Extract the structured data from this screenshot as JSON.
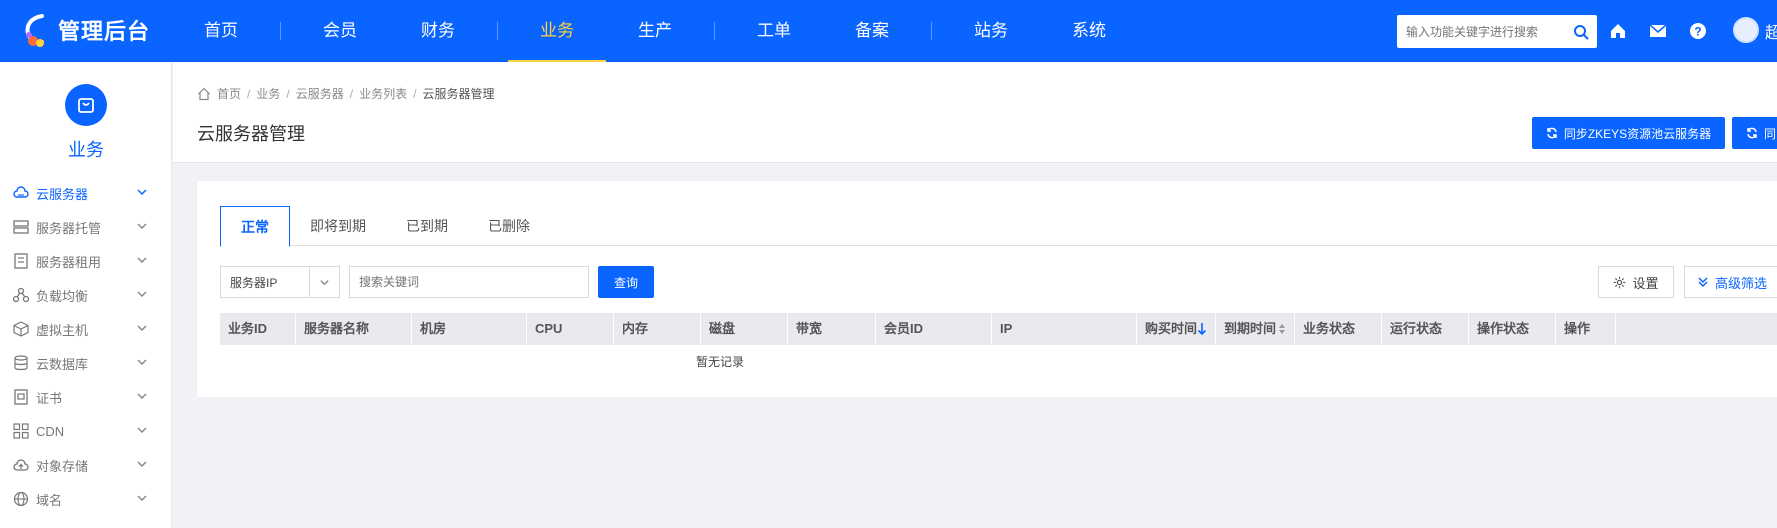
{
  "brand": {
    "name": "管理后台"
  },
  "topnav": [
    {
      "label": "首页"
    },
    {
      "label": "会员"
    },
    {
      "label": "财务"
    },
    {
      "label": "业务",
      "active": true
    },
    {
      "label": "生产"
    },
    {
      "label": "工单"
    },
    {
      "label": "备案"
    },
    {
      "label": "站务"
    },
    {
      "label": "系统"
    }
  ],
  "search": {
    "placeholder": "输入功能关键字进行搜索",
    "icon": "search-icon"
  },
  "user": {
    "name": "超"
  },
  "sidebar": {
    "title": "业务",
    "items": [
      {
        "label": "云服务器",
        "icon": "cloud-icon",
        "active": true
      },
      {
        "label": "服务器托管",
        "icon": "rack-icon"
      },
      {
        "label": "服务器租用",
        "icon": "server-icon"
      },
      {
        "label": "负载均衡",
        "icon": "network-icon"
      },
      {
        "label": "虚拟主机",
        "icon": "cube-icon"
      },
      {
        "label": "云数据库",
        "icon": "database-icon"
      },
      {
        "label": "证书",
        "icon": "certificate-icon"
      },
      {
        "label": "CDN",
        "icon": "grid-icon"
      },
      {
        "label": "对象存储",
        "icon": "cloud-upload-icon"
      },
      {
        "label": "域名",
        "icon": "globe-icon"
      }
    ]
  },
  "breadcrumb": [
    "首页",
    "业务",
    "云服务器",
    "业务列表",
    "云服务器管理"
  ],
  "page_title": "云服务器管理",
  "actions": {
    "sync_zkeys": "同步ZKEYS资源池云服务器",
    "sync_other": "同"
  },
  "tabs": [
    {
      "label": "正常",
      "active": true
    },
    {
      "label": "即将到期"
    },
    {
      "label": "已到期"
    },
    {
      "label": "已删除"
    }
  ],
  "filter": {
    "field_select": "服务器IP",
    "keyword_placeholder": "搜索关键词",
    "query_label": "查询",
    "settings_label": "设置",
    "advanced_label": "高级筛选"
  },
  "table": {
    "columns": [
      "业务ID",
      "服务器名称",
      "机房",
      "CPU",
      "内存",
      "磁盘",
      "带宽",
      "会员ID",
      "IP",
      "购买时间",
      "到期时间",
      "业务状态",
      "运行状态",
      "操作状态",
      "操作"
    ],
    "empty_text": "暂无记录"
  },
  "colors": {
    "primary": "#0a64ff",
    "active_nav": "#ffd33d"
  }
}
